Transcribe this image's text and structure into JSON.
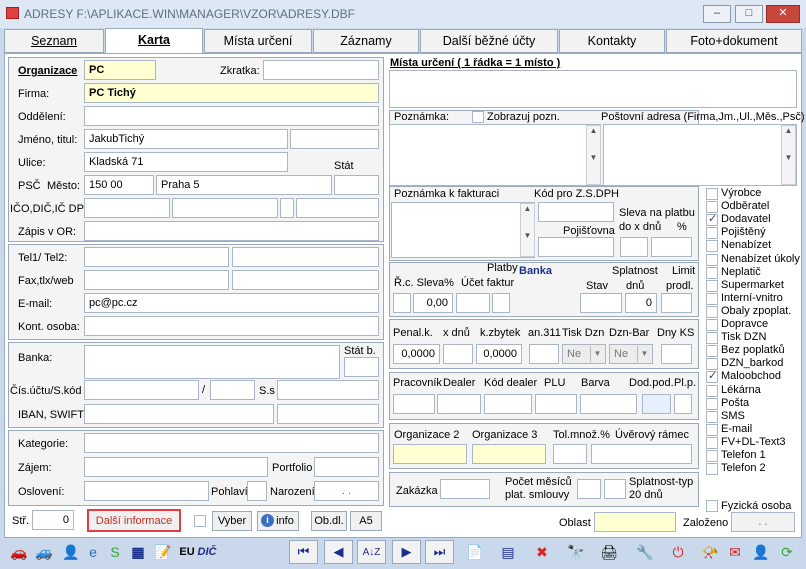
{
  "window": {
    "title": "ADRESY F:\\APLIKACE.WIN\\MANAGER\\VZOR\\ADRESY.DBF",
    "minimize": "–",
    "maximize": "□",
    "close": "✕"
  },
  "tabs": [
    "Seznam",
    "Karta",
    "Místa určení",
    "Záznamy",
    "Další běžné účty",
    "Kontakty",
    "Foto+dokument"
  ],
  "labels": {
    "organizace": "Organizace",
    "zkratka": "Zkratka:",
    "firma": "Firma:",
    "oddeleni": "Oddělení:",
    "jmeno": "Jméno, titul:",
    "ulice": "Ulice:",
    "stat": "Stát",
    "psc": "PSČ",
    "mesto": "Město:",
    "ico": "IČO,DIČ,IČ DPH",
    "zapis": "Zápis v OR:",
    "tel": "Tel1/ Tel2:",
    "fax": "Fax,tlx/web",
    "email": "E-mail:",
    "kont": "Kont. osoba:",
    "banka": "Banka:",
    "statb": "Stát b.",
    "cisuctu": "Čís.účtu/S.kód",
    "slash": "/",
    "ss": "S.s",
    "iban": "IBAN, SWIFT",
    "kategorie": "Kategorie:",
    "zajem": "Zájem:",
    "portfolio": "Portfolio",
    "osloveni": "Oslovení:",
    "pohlavi": "Pohlaví",
    "narozeni": "Narození",
    "str": "Stř.",
    "mista": "Místa určení ( 1 řádka = 1 místo )",
    "poznamka": "Poznámka:",
    "zobrazuj": "Zobrazuj pozn.",
    "postovni": "Poštovní adresa (Firma,Jm.,Ul.,Měs.,Psč)",
    "poznfakt": "Poznámka k fakturaci",
    "kodpro": "Kód pro Z.S.DPH",
    "pojistovna": "Pojišťovna",
    "sleva_platbu": "Sleva na platbu",
    "do_x_dnu": "do x dnů",
    "pct": "%",
    "platby": "Platby",
    "banka_blue": "Banka",
    "splatnost": "Splatnost",
    "dnu": "dnů",
    "limit": "Limit",
    "prodl": "prodl.",
    "r_c_sleva": "Ř.c. Sleva%",
    "ucet_faktur": "Účet faktur",
    "stav": "Stav",
    "penal": "Penal.k.",
    "xdnu": "x dnů",
    "kzbytek": "k.zbytek",
    "an311": "an.311",
    "tisk_dzn": "Tisk Dzn",
    "dzn_bar": "Dzn-Bar",
    "dny_ks": "Dny KS",
    "pracovnik": "Pracovník",
    "dealer": "Dealer",
    "kod_dealer": "Kód dealer",
    "plu": "PLU",
    "barva": "Barva",
    "dod_pod": "Dod.pod.",
    "pl_p": "Pl.p.",
    "org2": "Organizace 2",
    "org3": "Organizace 3",
    "tolmnoz": "Tol.množ.%",
    "uverovy": "Úvěrový rámec",
    "zakazka": "Zakázka",
    "pocet1": "Počet měsíců",
    "pocet2": "plat. smlouvy",
    "splatnost_typ1": "Splatnost-typ",
    "splatnost_typ2": "20 dnů",
    "oblast": "Oblast",
    "zalozeno": "Založeno",
    "fyzicka": "Fyzická osoba"
  },
  "values": {
    "organizace": "PC",
    "firma": "PC Tichý",
    "jmeno": "JakubTichý",
    "ulice": "Kladská 71",
    "psc": "150 00",
    "mesto": "Praha 5",
    "email": "pc@pc.cz",
    "sleva": "0,00",
    "splatnost": "0",
    "penal": "0,0000",
    "kzbytek": "0,0000",
    "tisk_dzn": "Ne",
    "dzn_bar": "Ne",
    "str": "0",
    "narozeni": ". .",
    "zalozeno": ". ."
  },
  "buttons": {
    "dalsi": "Další informace",
    "vyber": "Vyber",
    "info": "info",
    "obdl": "Ob.dl.",
    "a5": "A5"
  },
  "checklist": [
    {
      "label": "Výrobce",
      "checked": false
    },
    {
      "label": "Odběratel",
      "checked": false
    },
    {
      "label": "Dodavatel",
      "checked": true
    },
    {
      "label": "Pojištěný",
      "checked": false
    },
    {
      "label": "Nenabízet",
      "checked": false
    },
    {
      "label": "Nenabízet úkoly",
      "checked": false
    },
    {
      "label": "Neplatič",
      "checked": false
    },
    {
      "label": "Supermarket",
      "checked": false
    },
    {
      "label": "Interní-vnitro",
      "checked": false
    },
    {
      "label": "Obaly zpoplat.",
      "checked": false
    },
    {
      "label": "Dopravce",
      "checked": false
    },
    {
      "label": "Tisk DZN",
      "checked": false
    },
    {
      "label": "Bez poplatků",
      "checked": false
    },
    {
      "label": "DZN_barkod",
      "checked": false
    },
    {
      "label": "Maloobchod",
      "checked": true
    },
    {
      "label": "Lékárna",
      "checked": false
    },
    {
      "label": "Pošta",
      "checked": false
    },
    {
      "label": "SMS",
      "checked": false
    },
    {
      "label": "E-mail",
      "checked": false
    },
    {
      "label": "FV+DL-Text3",
      "checked": false
    },
    {
      "label": "Telefon 1",
      "checked": false
    },
    {
      "label": "Telefon 2",
      "checked": false
    }
  ],
  "toolbar": {
    "eu": "EU",
    "dic": "DIČ",
    "az": "A↓Z"
  }
}
